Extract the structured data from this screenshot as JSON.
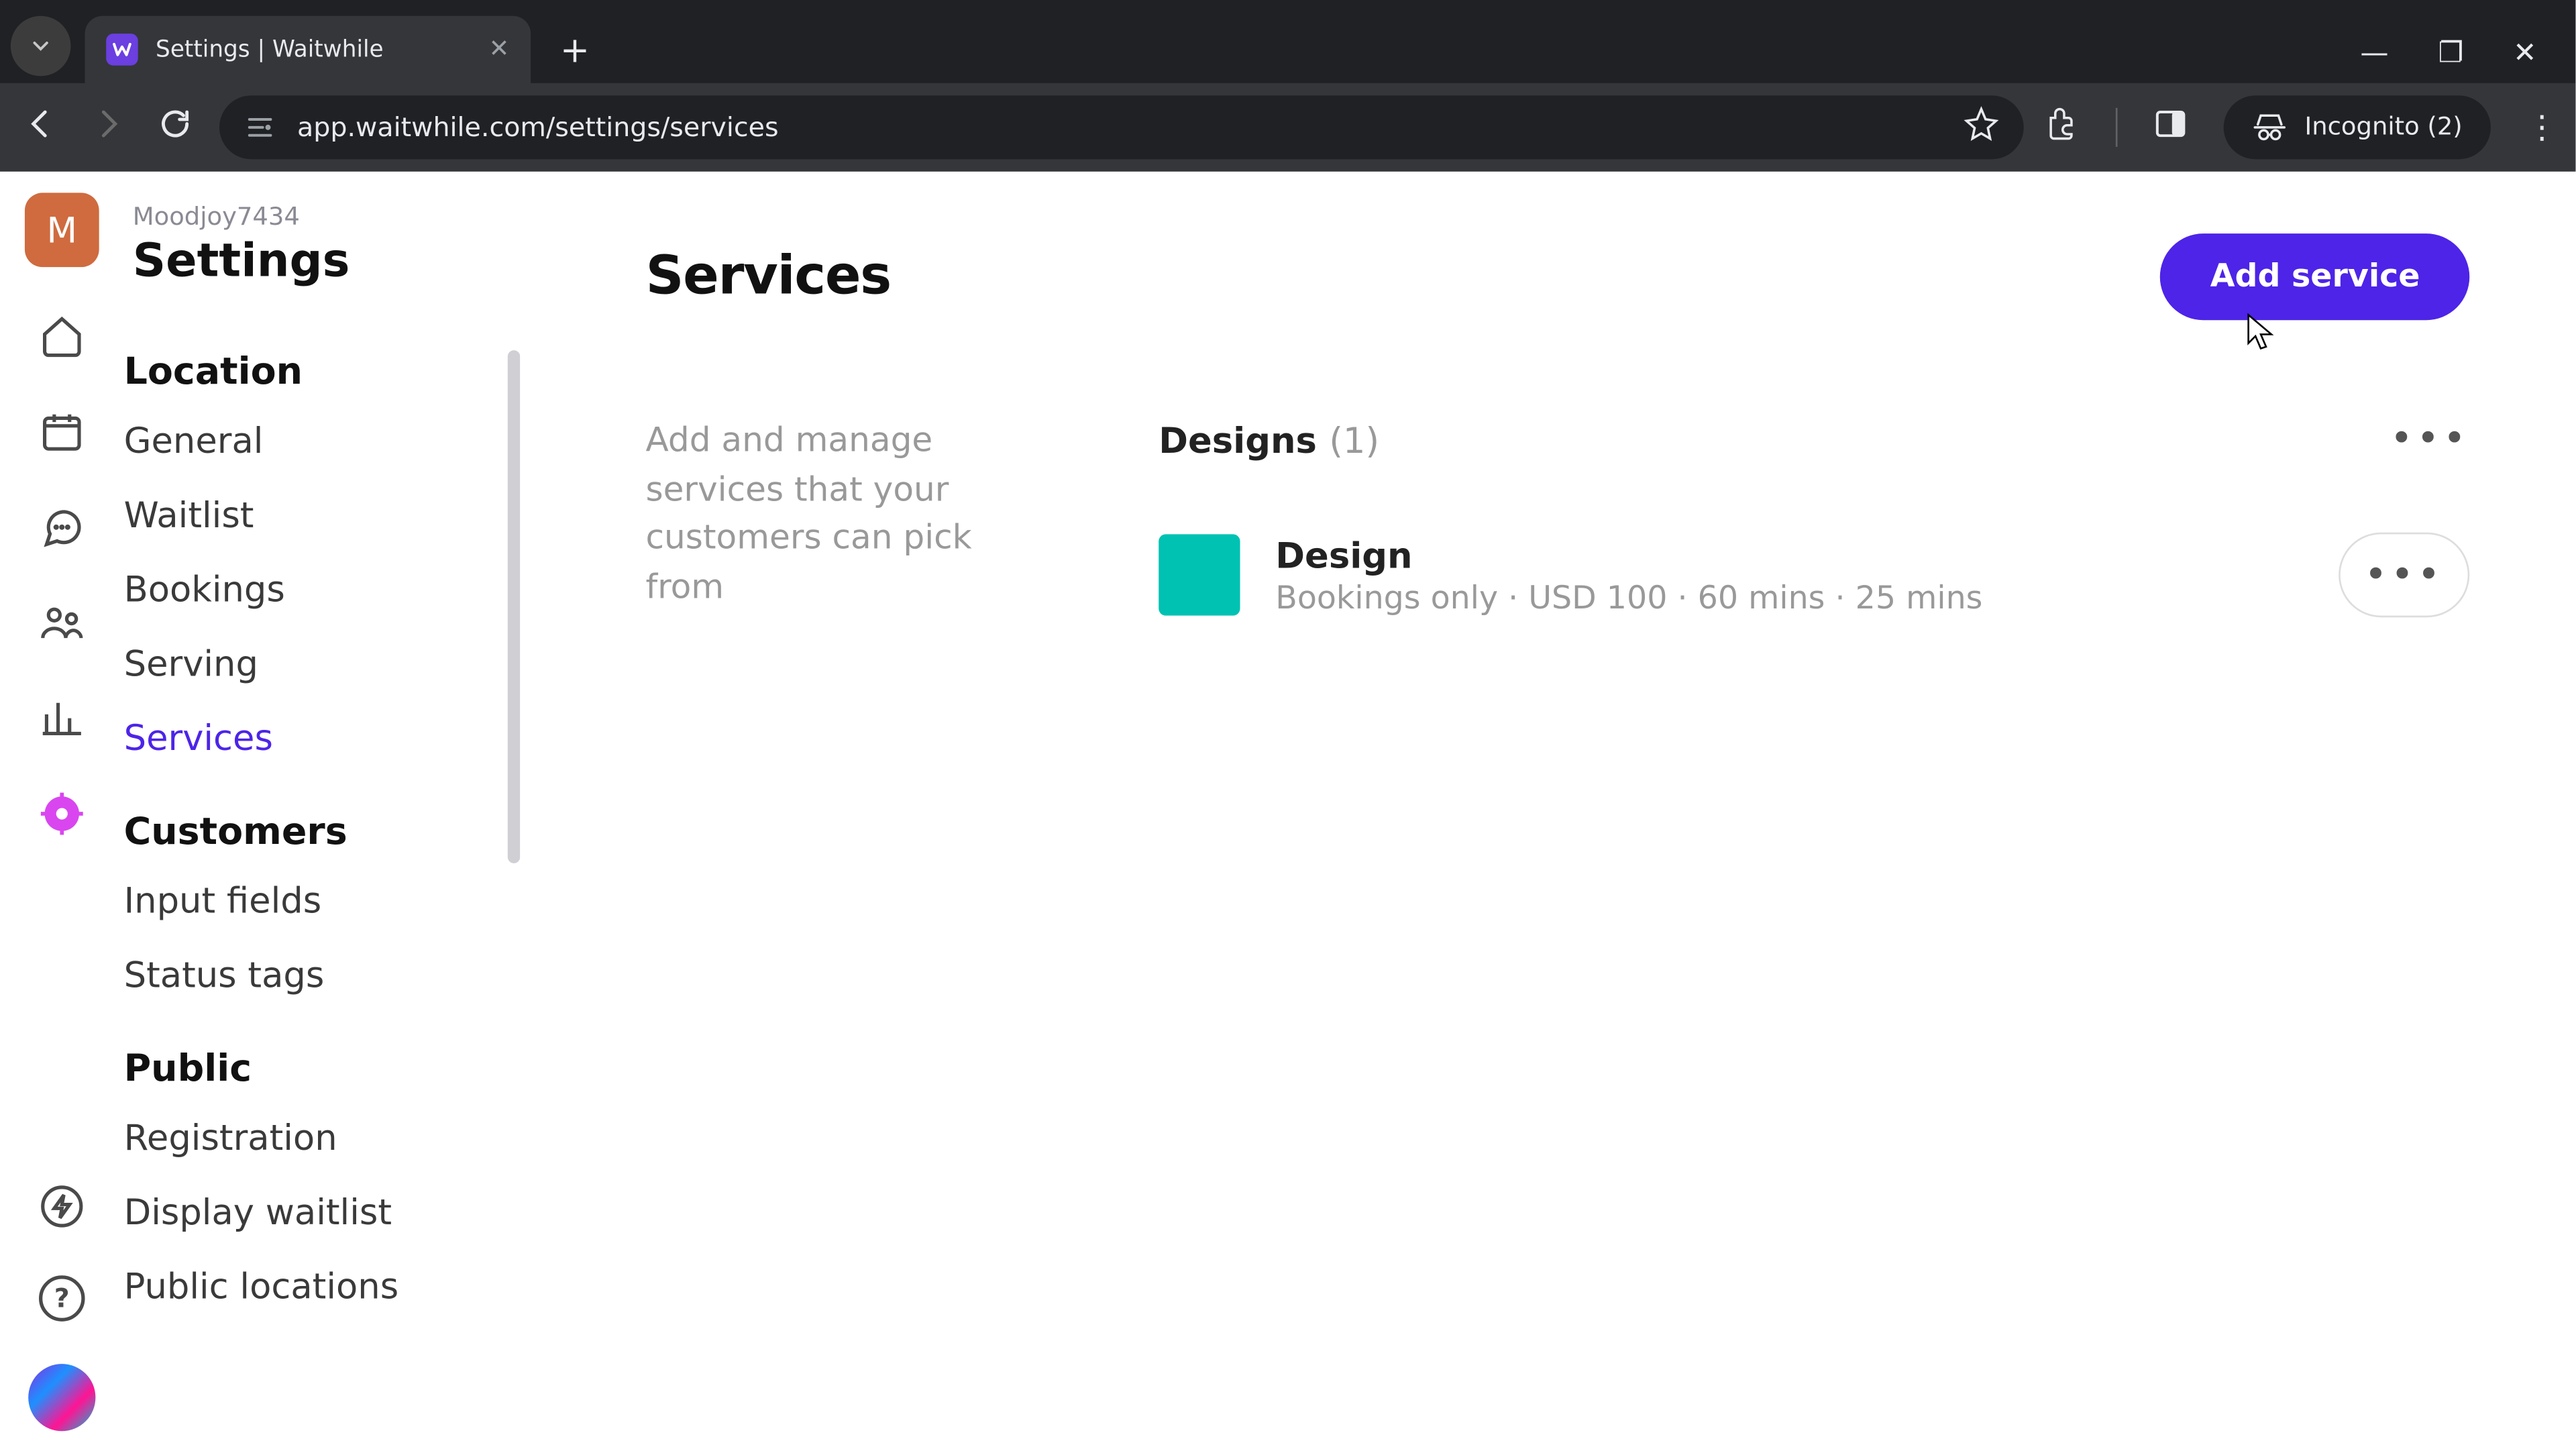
{
  "browser": {
    "tab_title": "Settings | Waitwhile",
    "url": "app.waitwhile.com/settings/services",
    "incognito_label": "Incognito (2)"
  },
  "rail": {
    "avatar_letter": "M"
  },
  "sidebar": {
    "org": "Moodjoy7434",
    "title": "Settings",
    "groups": [
      {
        "heading": "Location",
        "items": [
          "General",
          "Waitlist",
          "Bookings",
          "Serving",
          "Services"
        ],
        "active_index": 4
      },
      {
        "heading": "Customers",
        "items": [
          "Input fields",
          "Status tags"
        ]
      },
      {
        "heading": "Public",
        "items": [
          "Registration",
          "Display waitlist",
          "Public locations"
        ]
      }
    ]
  },
  "main": {
    "title": "Services",
    "add_button": "Add service",
    "description": "Add and manage services that your customers can pick from",
    "group": {
      "name": "Designs",
      "count": "(1)",
      "service": {
        "name": "Design",
        "swatch": "#00c2b2",
        "meta": "Bookings only · USD 100 · 60 mins · 25 mins"
      }
    },
    "more_glyph": "•••"
  }
}
